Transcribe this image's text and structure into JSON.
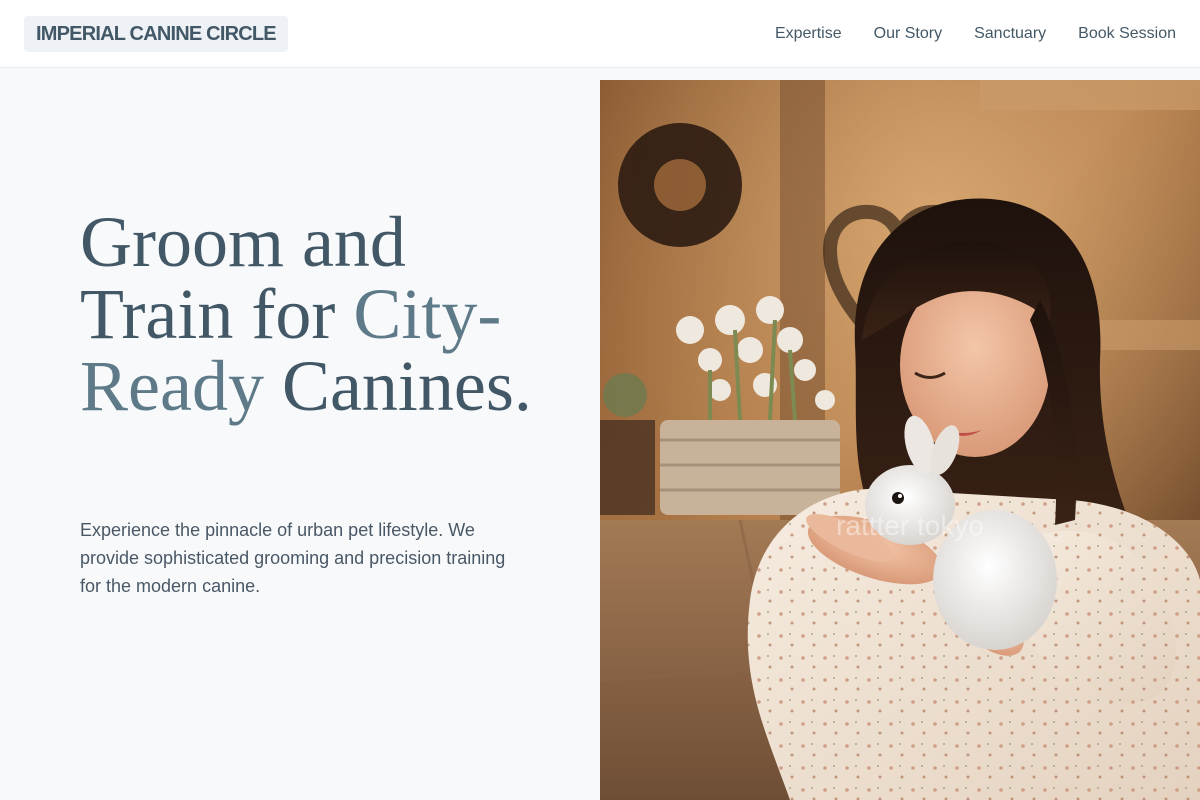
{
  "brand": {
    "name": "IMPERIAL CANINE CIRCLE"
  },
  "nav": {
    "links": [
      {
        "label": "Expertise"
      },
      {
        "label": "Our Story"
      },
      {
        "label": "Sanctuary"
      },
      {
        "label": "Book Session"
      }
    ]
  },
  "hero": {
    "title_part1": "Groom and Train for ",
    "title_accent": "City-Ready",
    "title_part2": " Canines.",
    "description": "Experience the pinnacle of urban pet lifestyle. We provide sophisticated grooming and precision training for the modern canine.",
    "image_watermark": "rattter tokyo"
  },
  "colors": {
    "text_primary": "#435866",
    "text_accent": "#5e7a88",
    "background": "#f7f9fb",
    "logo_background": "#eef2f6"
  }
}
